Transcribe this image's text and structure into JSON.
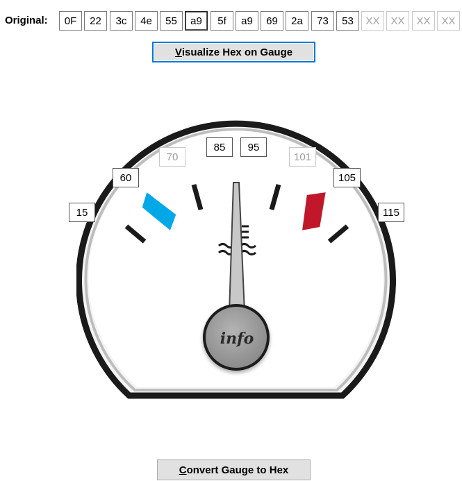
{
  "hex_row": {
    "label": "Original:",
    "cells": [
      "0F",
      "22",
      "3c",
      "4e",
      "55",
      "a9",
      "5f",
      "a9",
      "69",
      "2a",
      "73",
      "53",
      "XX",
      "XX",
      "XX",
      "XX"
    ],
    "focused_index": 5,
    "empty_value": "XX"
  },
  "buttons": {
    "visualize": {
      "accel": "V",
      "rest": "isualize Hex on Gauge"
    },
    "convert": {
      "accel": "C",
      "rest": "onvert Gauge to Hex"
    }
  },
  "gauge": {
    "center_label": "info",
    "tick_labels": [
      "15",
      "60",
      "70",
      "85",
      "95",
      "101",
      "105",
      "115"
    ],
    "dim_ticks": [
      "70",
      "101"
    ],
    "colors": {
      "cold": "#00a8e8",
      "hot": "#c0182a",
      "ring": "#1a1a1a",
      "needle": "#c8c8c8",
      "hub": "#9a9a9a"
    }
  }
}
